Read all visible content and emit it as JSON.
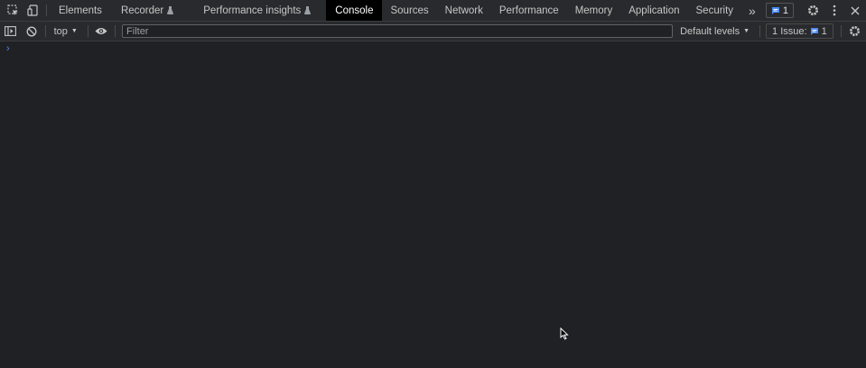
{
  "tabbar": {
    "tabs": [
      {
        "label": "Elements",
        "active": false,
        "experimental": false
      },
      {
        "label": "Recorder",
        "active": false,
        "experimental": true
      },
      {
        "label": "Performance insights",
        "active": false,
        "experimental": true
      },
      {
        "label": "Console",
        "active": true,
        "experimental": false
      },
      {
        "label": "Sources",
        "active": false,
        "experimental": false
      },
      {
        "label": "Network",
        "active": false,
        "experimental": false
      },
      {
        "label": "Performance",
        "active": false,
        "experimental": false
      },
      {
        "label": "Memory",
        "active": false,
        "experimental": false
      },
      {
        "label": "Application",
        "active": false,
        "experimental": false
      },
      {
        "label": "Security",
        "active": false,
        "experimental": false
      }
    ],
    "more_tabs": "»",
    "issue_count": "1"
  },
  "toolbar": {
    "context": "top",
    "filter_placeholder": "Filter",
    "levels": "Default levels",
    "issues_label": "1 Issue:",
    "issues_count": "1"
  },
  "console": {
    "prompt": "›"
  },
  "colors": {
    "background": "#202124",
    "toolbar": "#292a2d",
    "active_tab": "#000000",
    "accent": "#4d8cf5"
  }
}
